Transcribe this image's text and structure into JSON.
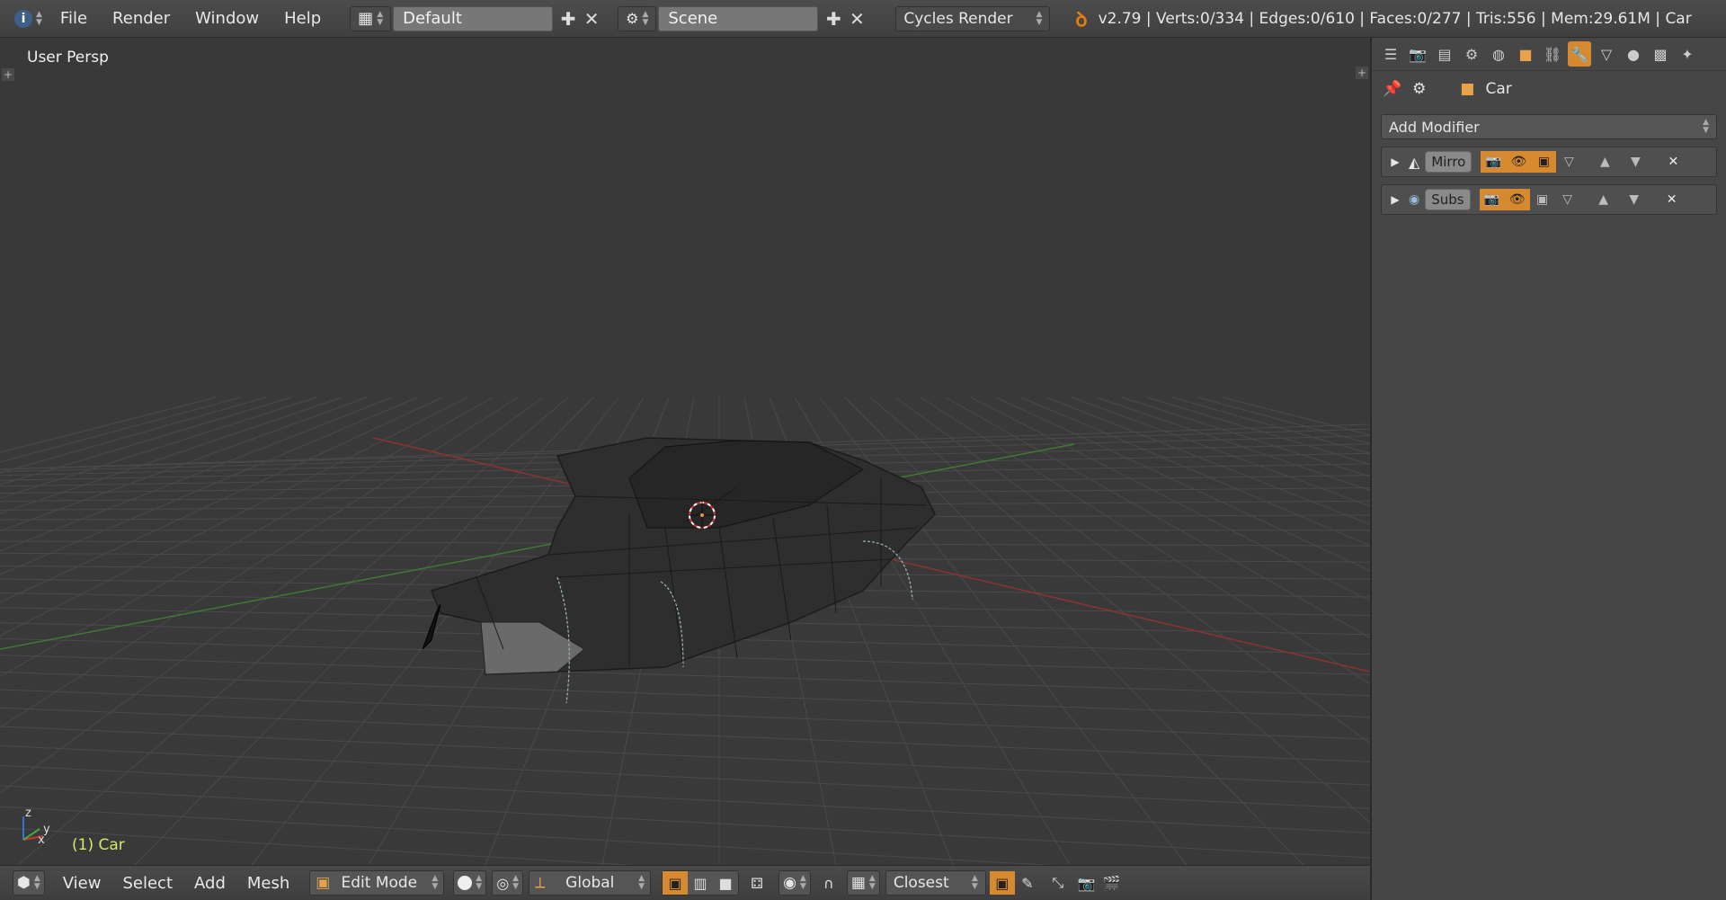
{
  "topbar": {
    "menus": [
      "File",
      "Render",
      "Window",
      "Help"
    ],
    "screen_layout": "Default",
    "scene": "Scene",
    "engine": "Cycles Render",
    "stats": "v2.79 | Verts:0/334 | Edges:0/610 | Faces:0/277 | Tris:556 | Mem:29.61M | Car"
  },
  "viewport": {
    "view_label": "User Persp",
    "object_label": "(1) Car",
    "axis_z": "z",
    "axis_x": "x",
    "axis_y": "y"
  },
  "bottombar": {
    "menus": [
      "View",
      "Select",
      "Add",
      "Mesh"
    ],
    "mode": "Edit Mode",
    "orientation": "Global",
    "snap_target": "Closest"
  },
  "properties": {
    "context_object": "Car",
    "add_modifier_label": "Add Modifier",
    "modifiers": [
      {
        "name": "Mirro"
      },
      {
        "name": "Subs"
      }
    ]
  },
  "colors": {
    "accent": "#d6892e",
    "object_label": "#d7e86a",
    "x_axis": "#a33",
    "y_axis": "#4a8a3a"
  }
}
